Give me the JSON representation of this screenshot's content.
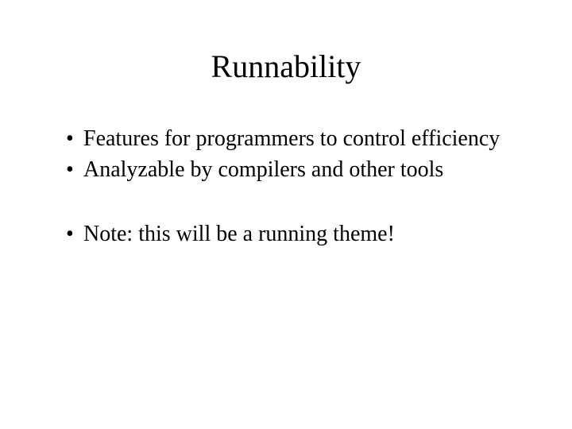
{
  "slide": {
    "title": "Runnability",
    "bullets_group1": [
      "Features for programmers to control efficiency",
      "Analyzable by compilers and other tools"
    ],
    "bullets_group2": [
      "Note: this will be a running theme!"
    ]
  }
}
